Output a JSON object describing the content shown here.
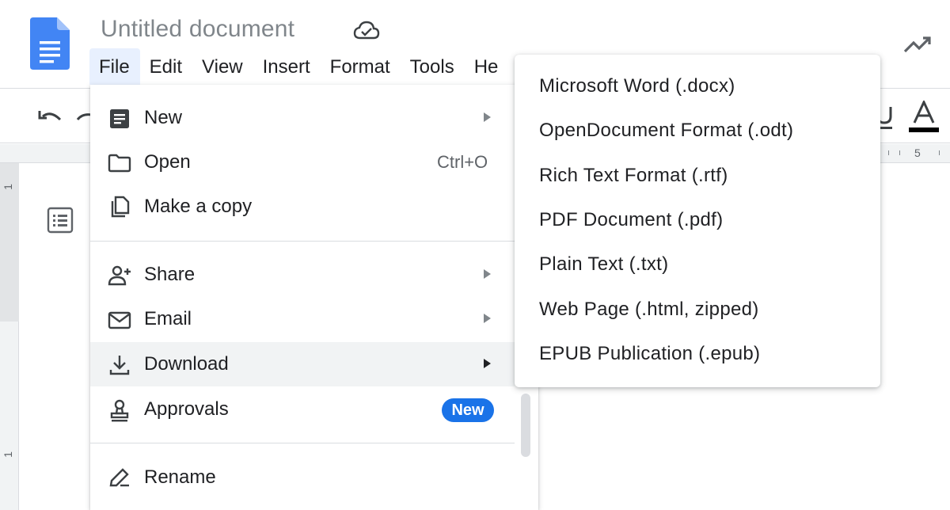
{
  "header": {
    "doc_title": "Untitled document",
    "icons": {
      "app": "docs-logo",
      "save_status": "cloud-check-icon",
      "activity": "trending-up-icon"
    }
  },
  "menubar": {
    "items": [
      {
        "label": "File",
        "active": true
      },
      {
        "label": "Edit"
      },
      {
        "label": "View"
      },
      {
        "label": "Insert"
      },
      {
        "label": "Format"
      },
      {
        "label": "Tools"
      },
      {
        "label": "He"
      }
    ]
  },
  "ruler": {
    "top_number": "5",
    "left_numbers": [
      "1",
      "1"
    ]
  },
  "file_menu": {
    "items": [
      {
        "label": "New",
        "icon": "document-icon",
        "has_submenu": true
      },
      {
        "label": "Open",
        "icon": "folder-icon",
        "shortcut": "Ctrl+O"
      },
      {
        "label": "Make a copy",
        "icon": "copy-icon"
      },
      {
        "label": "Share",
        "icon": "person-add-icon",
        "has_submenu": true
      },
      {
        "label": "Email",
        "icon": "email-icon",
        "has_submenu": true
      },
      {
        "label": "Download",
        "icon": "download-icon",
        "has_submenu": true,
        "highlighted": true
      },
      {
        "label": "Approvals",
        "icon": "approval-stamp-icon",
        "badge": "New"
      },
      {
        "label": "Rename",
        "icon": "rename-pencil-icon"
      }
    ]
  },
  "download_menu": {
    "items": [
      {
        "label": "Microsoft Word (.docx)"
      },
      {
        "label": "OpenDocument Format (.odt)"
      },
      {
        "label": "Rich Text Format (.rtf)"
      },
      {
        "label": "PDF Document (.pdf)"
      },
      {
        "label": "Plain Text (.txt)"
      },
      {
        "label": "Web Page (.html, zipped)"
      },
      {
        "label": "EPUB Publication (.epub)"
      }
    ]
  },
  "colors": {
    "accent": "#1a73e8",
    "menu_hover": "#f1f3f4",
    "active_menu": "#e8f0fe",
    "docs_blue": "#4285f4"
  }
}
